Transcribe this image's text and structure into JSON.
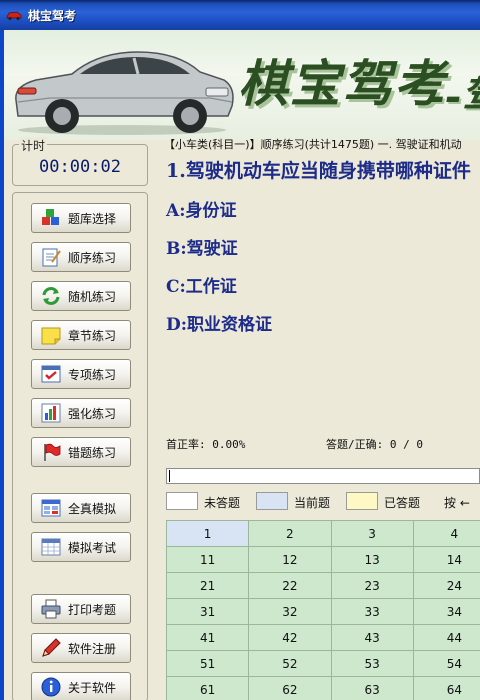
{
  "window": {
    "title": "棋宝驾考"
  },
  "banner": {
    "brand": "棋宝驾考",
    "brand_tail": "--驾"
  },
  "timer": {
    "label": "计时",
    "value": "00:00:02"
  },
  "nav": [
    {
      "label": "题库选择",
      "icon": "blocks-icon"
    },
    {
      "label": "顺序练习",
      "icon": "notepad-icon"
    },
    {
      "label": "随机练习",
      "icon": "refresh-icon"
    },
    {
      "label": "章节练习",
      "icon": "sticky-note-icon"
    },
    {
      "label": "专项练习",
      "icon": "checklist-icon"
    },
    {
      "label": "强化练习",
      "icon": "bar-chart-icon"
    },
    {
      "label": "错题练习",
      "icon": "red-flag-icon"
    },
    {
      "label": "全真模拟",
      "icon": "window-grid-icon"
    },
    {
      "label": "模拟考试",
      "icon": "calendar-grid-icon"
    },
    {
      "label": "打印考题",
      "icon": "printer-icon"
    },
    {
      "label": "软件注册",
      "icon": "pen-icon"
    },
    {
      "label": "关于软件",
      "icon": "info-icon"
    }
  ],
  "breadcrumb": "【小车类(科目一)】顺序练习(共计1475题) 一. 驾驶证和机动",
  "question": {
    "text": "1.驾驶机动车应当随身携带哪种证件"
  },
  "options": [
    "A:身份证",
    "B:驾驶证",
    "C:工作证",
    "D:职业资格证"
  ],
  "stats": {
    "accuracy": "首正率: 0.00%",
    "answered": "答题/正确: 0 / 0"
  },
  "legend": {
    "unanswered": "未答题",
    "current": "当前题",
    "answered": "已答题",
    "hint": "按 ←"
  },
  "colors": {
    "unanswered": "#ffffff",
    "current": "#d8e3f3",
    "answered": "#fdf8c4",
    "cell": "#cde8cd",
    "question_text": "#1d2c8a"
  },
  "grid": [
    [
      "1",
      "2",
      "3",
      "4"
    ],
    [
      "11",
      "12",
      "13",
      "14"
    ],
    [
      "21",
      "22",
      "23",
      "24"
    ],
    [
      "31",
      "32",
      "33",
      "34"
    ],
    [
      "41",
      "42",
      "43",
      "44"
    ],
    [
      "51",
      "52",
      "53",
      "54"
    ],
    [
      "61",
      "62",
      "63",
      "64"
    ]
  ]
}
